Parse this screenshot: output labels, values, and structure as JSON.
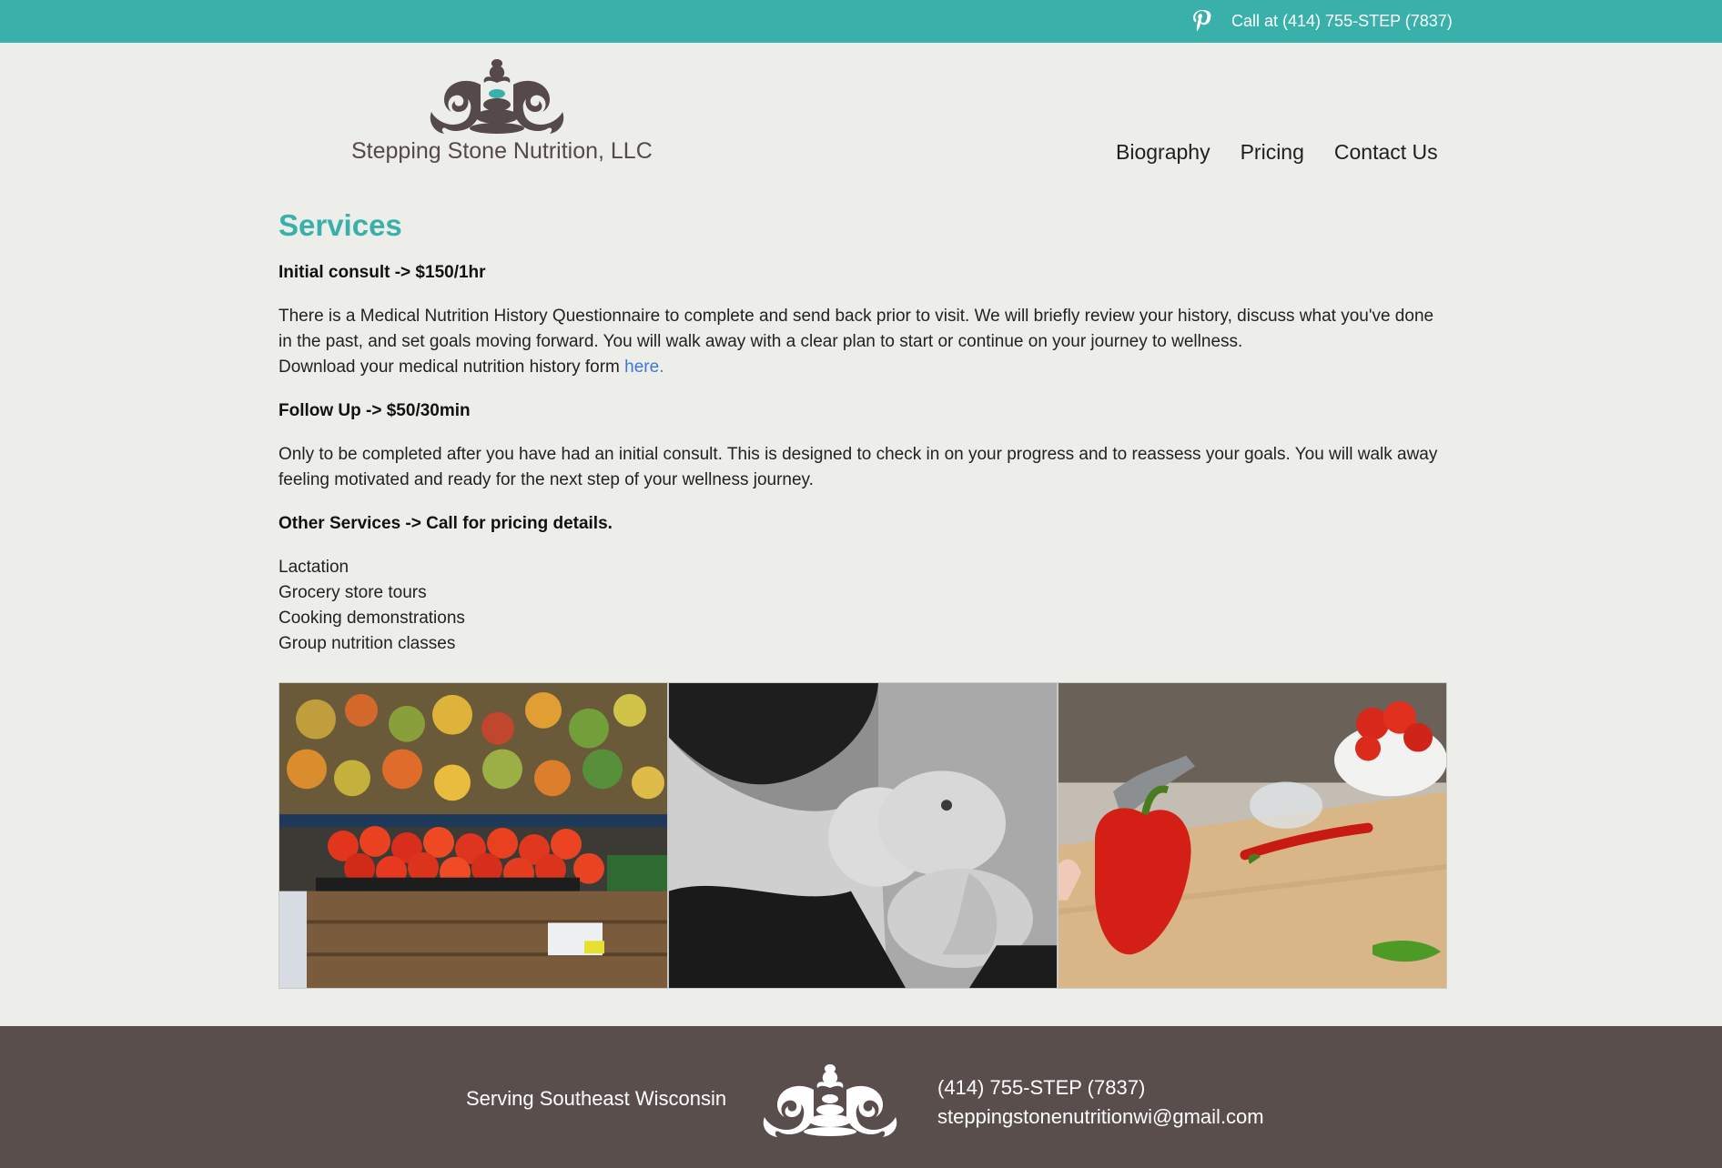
{
  "topbar": {
    "pin_icon": "pinterest-icon",
    "call": "Call at (414) 755-STEP (7837)",
    "color": "#3ab0ab"
  },
  "header": {
    "logo_icon": "ornamental-stone-stack-logo",
    "brand": "Stepping Stone Nutrition, LLC",
    "nav": [
      "Biography",
      "Pricing",
      "Contact Us"
    ]
  },
  "main": {
    "title": "Services",
    "initial": {
      "heading": "Initial consult -> $150/1hr",
      "text": "There is a Medical Nutrition History Questionnaire to complete and send back prior to visit. We will briefly review your history, discuss what you've done in the past, and set goals moving forward. You will walk away with a clear plan to start or continue on your journey to wellness.",
      "download_prefix": "Download your medical nutrition history form ",
      "download_link": "here."
    },
    "followup": {
      "heading": "Follow Up -> $50/30min",
      "text": "Only to be completed after you have had an initial consult. This is designed to check in on your progress and to reassess your goals. You will walk away feeling motivated and ready for the next step of your wellness journey."
    },
    "other": {
      "heading": "Other Services -> Call for pricing details.",
      "items": [
        "Lactation",
        "Grocery store tours",
        "Cooking demonstrations",
        "Group nutrition classes"
      ]
    }
  },
  "photos": [
    "grocery-produce-photo",
    "breastfeeding-photo",
    "cooking-peppers-photo"
  ],
  "footer": {
    "serving": "Serving Southeast Wisconsin",
    "logo_icon": "ornamental-stone-stack-logo",
    "phone": "(414) 755-STEP (7837)",
    "email": "steppingstonenutritionwi@gmail.com"
  },
  "colors": {
    "accent": "#3ab0ab",
    "link": "#3b78d8",
    "footer_bg": "#5a4e4d",
    "page_bg": "#ededea"
  }
}
